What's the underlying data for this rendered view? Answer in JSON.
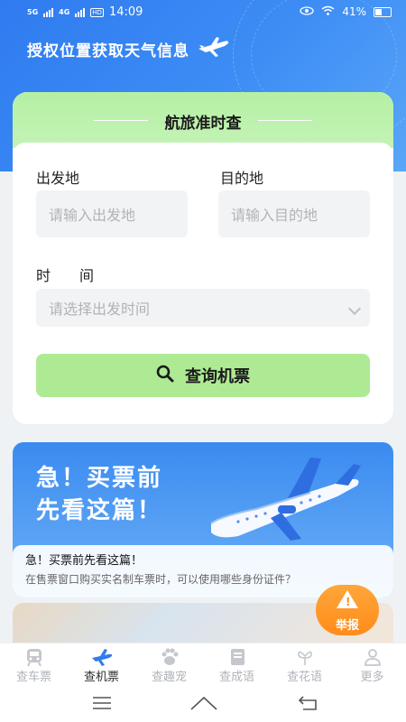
{
  "status": {
    "signal1": "5G",
    "signal2": "4G",
    "hd": "HD",
    "time": "14:09",
    "battery": "41%"
  },
  "header": {
    "title": "授权位置获取天气信息"
  },
  "query": {
    "title": "航旅准时查",
    "from_label": "出发地",
    "from_placeholder": "请输入出发地",
    "to_label": "目的地",
    "to_placeholder": "请输入目的地",
    "time_label": "时　　间",
    "time_placeholder": "请选择出发时间",
    "search_label": "查询机票"
  },
  "banner": {
    "line1": "急！买票前",
    "line2": "先看这篇！",
    "article_title": "急！买票前先看这篇！",
    "article_desc": "在售票窗口购买实名制车票时，可以使用哪些身份证件？"
  },
  "report": {
    "label": "举报"
  },
  "tabs": [
    {
      "label": "查车票",
      "icon": "train-icon"
    },
    {
      "label": "查机票",
      "icon": "plane-icon"
    },
    {
      "label": "查趣宠",
      "icon": "paw-icon"
    },
    {
      "label": "查成语",
      "icon": "book-icon"
    },
    {
      "label": "查花语",
      "icon": "flower-icon"
    },
    {
      "label": "更多",
      "icon": "person-icon"
    }
  ],
  "colors": {
    "primary": "#2f7bf0",
    "accent_green": "#aeea93",
    "report_orange": "#ff8c1a"
  }
}
